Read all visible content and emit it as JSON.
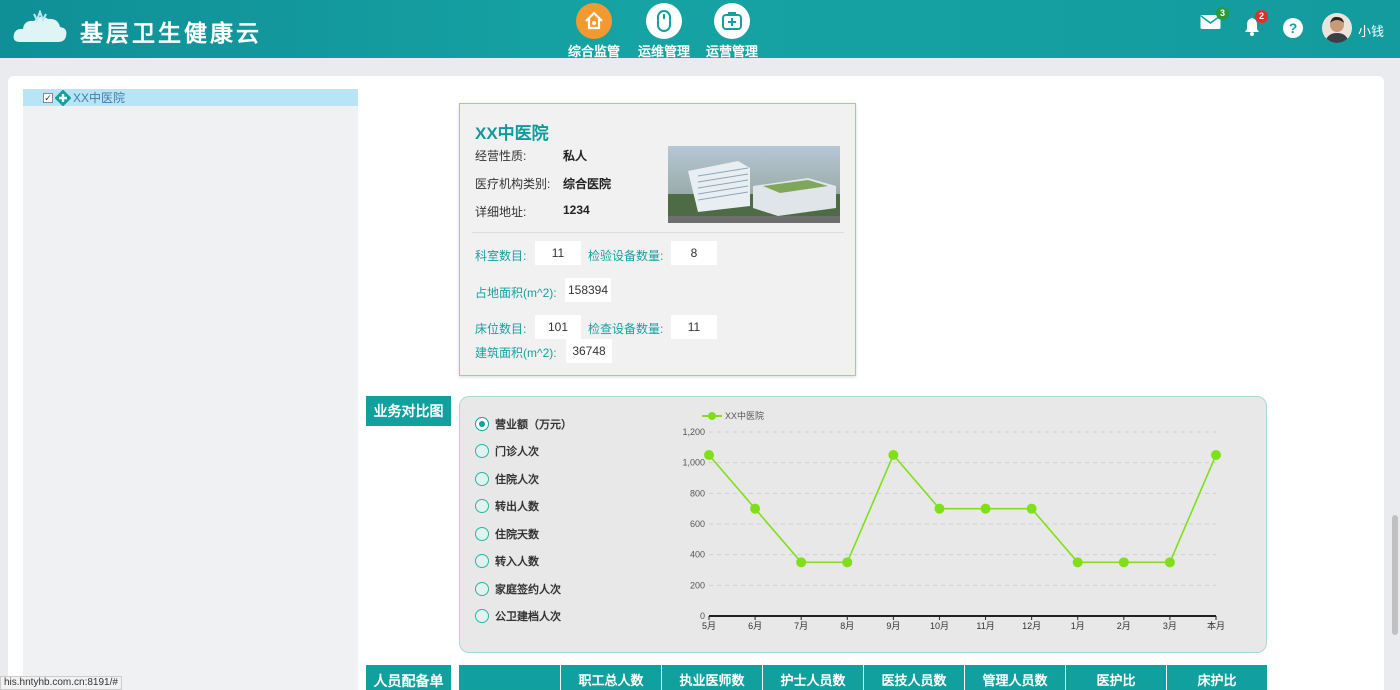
{
  "app": {
    "title": "基层卫生健康云"
  },
  "nav": [
    {
      "label": "综合监管",
      "icon": "home-icon"
    },
    {
      "label": "运维管理",
      "icon": "mouse-icon"
    },
    {
      "label": "运营管理",
      "icon": "medical-kit-icon"
    }
  ],
  "header_right": {
    "mail_badge": "3",
    "bell_badge": "2",
    "user_name": "小钱"
  },
  "colors": {
    "header": "#139b9e",
    "accent": "#12a09f",
    "series": "#7fe01a"
  },
  "tree": {
    "root_label": "XX中医院"
  },
  "hospital": {
    "name": "XX中医院",
    "fields": [
      {
        "label": "经营性质:",
        "value": "私人"
      },
      {
        "label": "医疗机构类别:",
        "value": "综合医院"
      },
      {
        "label": "详细地址:",
        "value": "1234"
      }
    ],
    "stats": {
      "dept_count_label": "科室数目:",
      "dept_count": "11",
      "inspect_equip_label": "检验设备数量:",
      "inspect_equip": "8",
      "land_area_label": "占地面积(m^2):",
      "land_area": "158394",
      "bed_count_label": "床位数目:",
      "bed_count": "101",
      "exam_equip_label": "检查设备数量:",
      "exam_equip": "11",
      "build_area_label": "建筑面积(m^2):",
      "build_area": "36748"
    }
  },
  "sections": {
    "biz_compare": "业务对比图",
    "staffing": "人员配备单"
  },
  "metrics": [
    {
      "label": "营业额（万元）",
      "checked": true
    },
    {
      "label": "门诊人次",
      "checked": false
    },
    {
      "label": "住院人次",
      "checked": false
    },
    {
      "label": "转出人数",
      "checked": false
    },
    {
      "label": "住院天数",
      "checked": false
    },
    {
      "label": "转入人数",
      "checked": false
    },
    {
      "label": "家庭签约人次",
      "checked": false
    },
    {
      "label": "公卫建档人次",
      "checked": false
    }
  ],
  "chart_data": {
    "type": "line",
    "categories": [
      "5月",
      "6月",
      "7月",
      "8月",
      "9月",
      "10月",
      "11月",
      "12月",
      "1月",
      "2月",
      "3月",
      "本月"
    ],
    "series": [
      {
        "name": "XX中医院",
        "values": [
          1050,
          700,
          350,
          350,
          1050,
          700,
          700,
          700,
          350,
          350,
          350,
          1050
        ]
      }
    ],
    "ylim": [
      0,
      1200
    ],
    "yticks": [
      "0",
      "200",
      "400",
      "600",
      "800",
      "1,000",
      "1,200"
    ],
    "grid": true,
    "legend": "top-left"
  },
  "staff_table": {
    "columns": [
      "",
      "职工总人数",
      "执业医师数",
      "护士人员数",
      "医技人员数",
      "管理人员数",
      "医护比",
      "床护比"
    ]
  },
  "status_url": "his.hntyhb.com.cn:8191/#"
}
